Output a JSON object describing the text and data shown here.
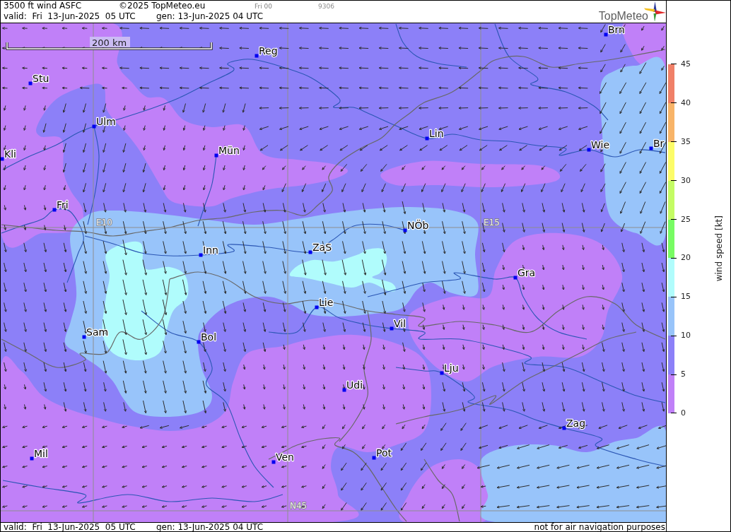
{
  "header": {
    "title": "3500 ft wind ASFC",
    "copyright": "©2025 TopMeteo.eu",
    "run": "Fri 00",
    "code": "9306",
    "valid": "valid:  Fri  13-Jun-2025  05 UTC",
    "generated": "gen: 13-Jun-2025 04 UTC"
  },
  "logo": {
    "text": "TopMeteo"
  },
  "map": {
    "scale_label": "200 km",
    "grid_labels": [
      "E10",
      "E15",
      "N45"
    ],
    "cities": [
      "Brn",
      "Reg",
      "Stu",
      "Ulm",
      "Lin",
      "Kli",
      "Mün",
      "Wie",
      "Br",
      "Fri",
      "NÖb",
      "Inn",
      "ZaS",
      "Gra",
      "Lie",
      "Sam",
      "Vil",
      "Bol",
      "Lju",
      "Udi",
      "Zag",
      "Mil",
      "Ven",
      "Pot"
    ]
  },
  "legend": {
    "title": "wind speed [kt]",
    "ticks": [
      "45",
      "40",
      "35",
      "30",
      "25",
      "20",
      "15",
      "10",
      "5",
      "0"
    ],
    "bands": [
      {
        "color": "#f08068"
      },
      {
        "color": "#f8b468"
      },
      {
        "color": "#fcfc68"
      },
      {
        "color": "#c4fc64"
      },
      {
        "color": "#78fc64"
      },
      {
        "color": "#b0fcfc"
      },
      {
        "color": "#98c4fa"
      },
      {
        "color": "#8c80f8"
      },
      {
        "color": "#c080f8"
      }
    ]
  },
  "footer": {
    "valid": "valid:  Fri  13-Jun-2025  05 UTC",
    "generated": "gen: 13-Jun-2025 04 UTC",
    "disclaimer": "not for air navigation purposes"
  }
}
